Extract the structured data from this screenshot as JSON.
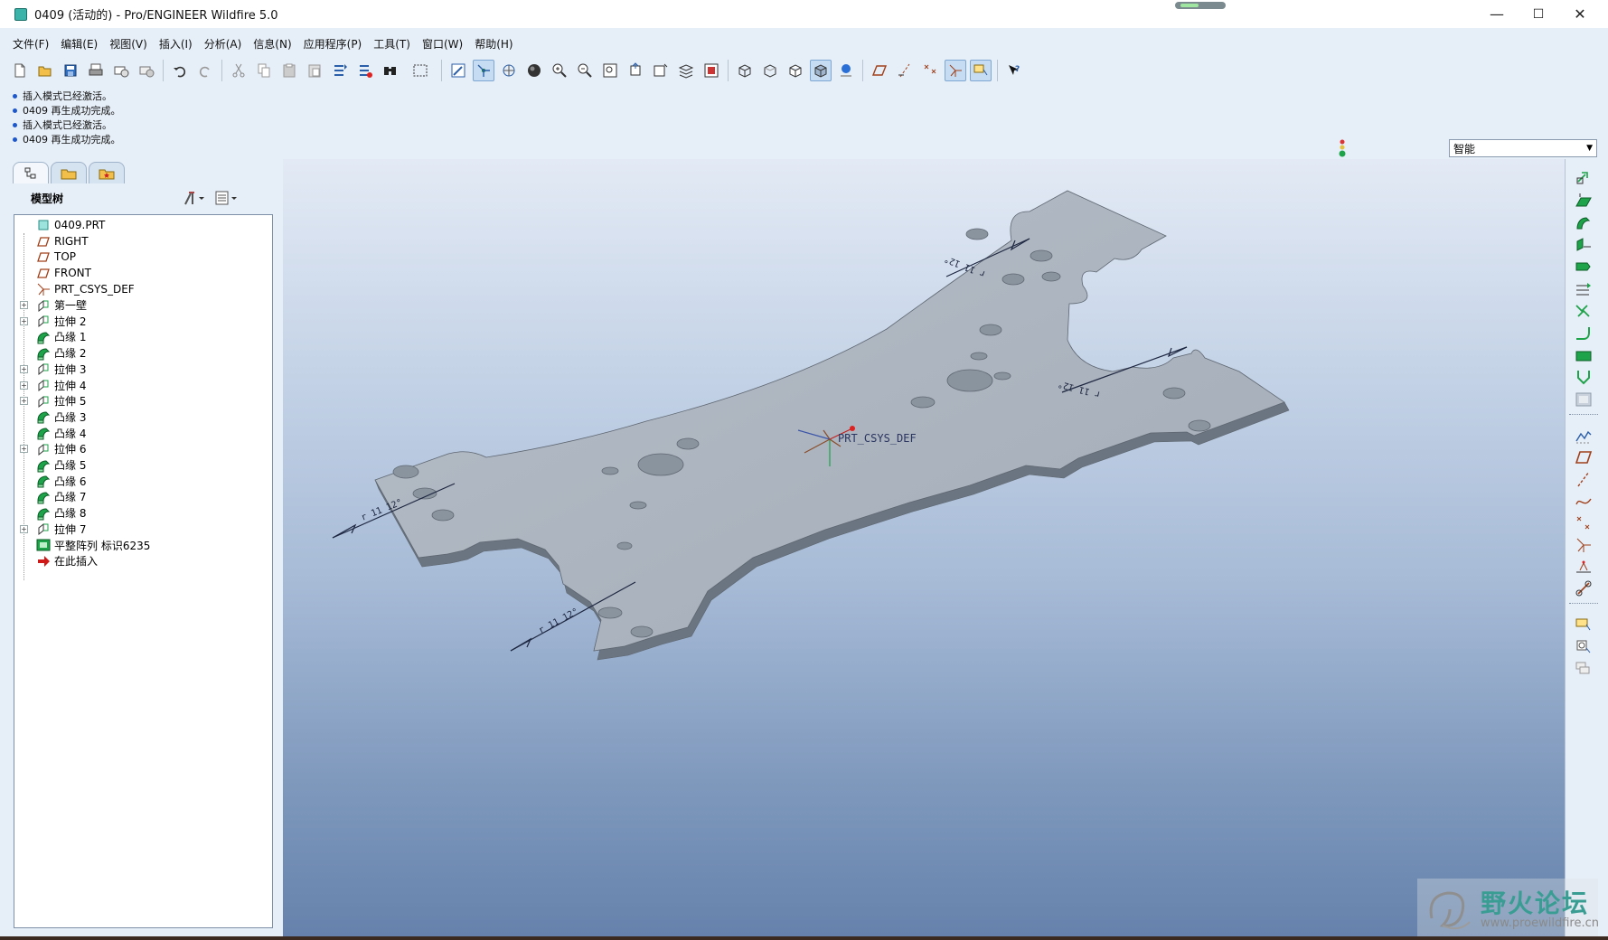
{
  "window": {
    "title": "0409 (活动的) - Pro/ENGINEER Wildfire 5.0",
    "controls": {
      "minimize": "—",
      "maximize": "☐",
      "close": "✕"
    }
  },
  "menubar": {
    "items": [
      "文件(F)",
      "编辑(E)",
      "视图(V)",
      "插入(I)",
      "分析(A)",
      "信息(N)",
      "应用程序(P)",
      "工具(T)",
      "窗口(W)",
      "帮助(H)"
    ]
  },
  "toolbar": {
    "icons": [
      "new-icon",
      "open-icon",
      "save-icon",
      "print-icon",
      "email-icon",
      "email-link-icon",
      "undo-icon",
      "redo-icon",
      "cut-icon",
      "copy-icon",
      "paste-icon",
      "paste-special-icon",
      "regenerate-icon",
      "regen-manager-icon",
      "find-icon",
      "select-box-icon",
      "repaint-icon",
      "spin-center-icon",
      "orient-mode-icon",
      "shading-icon",
      "zoom-in-icon",
      "zoom-out-icon",
      "refit-icon",
      "reorient-icon",
      "saved-views-icon",
      "layers-icon",
      "view-manager-icon",
      "wireframe-icon",
      "hidden-line-icon",
      "no-hidden-icon",
      "shaded-icon",
      "enhanced-realism-icon",
      "datum-planes-icon",
      "datum-axes-icon",
      "datum-points-icon",
      "csys-icon",
      "annotations-icon",
      "context-help-icon"
    ]
  },
  "messages": [
    "插入模式已经激活。",
    "0409 再生成功完成。",
    "插入模式已经激活。",
    "0409 再生成功完成。"
  ],
  "filter": {
    "value": "智能"
  },
  "model_tree": {
    "title": "模型树",
    "items": [
      {
        "label": "0409.PRT",
        "icon": "part-icon",
        "expandable": false
      },
      {
        "label": "RIGHT",
        "icon": "datum-plane-icon",
        "expandable": false
      },
      {
        "label": "TOP",
        "icon": "datum-plane-icon",
        "expandable": false
      },
      {
        "label": "FRONT",
        "icon": "datum-plane-icon",
        "expandable": false
      },
      {
        "label": "PRT_CSYS_DEF",
        "icon": "csys-icon",
        "expandable": false
      },
      {
        "label": "第一壁",
        "icon": "extrude-icon",
        "expandable": true
      },
      {
        "label": "拉伸 2",
        "icon": "extrude-icon",
        "expandable": true
      },
      {
        "label": "凸缘 1",
        "icon": "flange-icon",
        "expandable": false
      },
      {
        "label": "凸缘 2",
        "icon": "flange-icon",
        "expandable": false
      },
      {
        "label": "拉伸 3",
        "icon": "extrude-icon",
        "expandable": true
      },
      {
        "label": "拉伸 4",
        "icon": "extrude-icon",
        "expandable": true
      },
      {
        "label": "拉伸 5",
        "icon": "extrude-icon",
        "expandable": true
      },
      {
        "label": "凸缘 3",
        "icon": "flange-icon",
        "expandable": false
      },
      {
        "label": "凸缘 4",
        "icon": "flange-icon",
        "expandable": false
      },
      {
        "label": "拉伸 6",
        "icon": "extrude-icon",
        "expandable": true
      },
      {
        "label": "凸缘 5",
        "icon": "flange-icon",
        "expandable": false
      },
      {
        "label": "凸缘 6",
        "icon": "flange-icon",
        "expandable": false
      },
      {
        "label": "凸缘 7",
        "icon": "flange-icon",
        "expandable": false
      },
      {
        "label": "凸缘 8",
        "icon": "flange-icon",
        "expandable": false
      },
      {
        "label": "拉伸 7",
        "icon": "extrude-icon",
        "expandable": true
      },
      {
        "label": "平整阵列 标识6235",
        "icon": "flat-pattern-icon",
        "expandable": false
      },
      {
        "label": "在此插入",
        "icon": "insert-here-icon",
        "expandable": false
      }
    ]
  },
  "viewport": {
    "csys_label": "PRT_CSYS_DEF",
    "bend_labels": [
      "r 11 12°",
      "r 11 12°",
      "r 11 12°",
      "r 11 12°"
    ]
  },
  "right_toolbar": {
    "icons": [
      "convert-icon",
      "flat-wall-icon",
      "flange-wall-icon",
      "extend-wall-icon",
      "twist-wall-icon",
      "rip-icon",
      "merge-icon",
      "bend-icon",
      "unbend-icon",
      "bend-back-icon",
      "flat-pattern-icon",
      "sketch-icon",
      "datum-plane-icon",
      "datum-axis-icon",
      "datum-curve-icon",
      "datum-point-icon",
      "datum-csys-icon",
      "analysis-icon",
      "datum-link-icon",
      "annotation-feature-icon",
      "note-icon",
      "note-disabled-icon"
    ]
  },
  "watermark": {
    "name": "野火论坛",
    "url": "www.proewildfire.cn"
  },
  "colors": {
    "part": "#aab3bd",
    "part_edge": "#6f7883",
    "bg_top": "#e3eaf5",
    "bg_bottom": "#6682ac",
    "accent_green": "#1fa34a"
  }
}
